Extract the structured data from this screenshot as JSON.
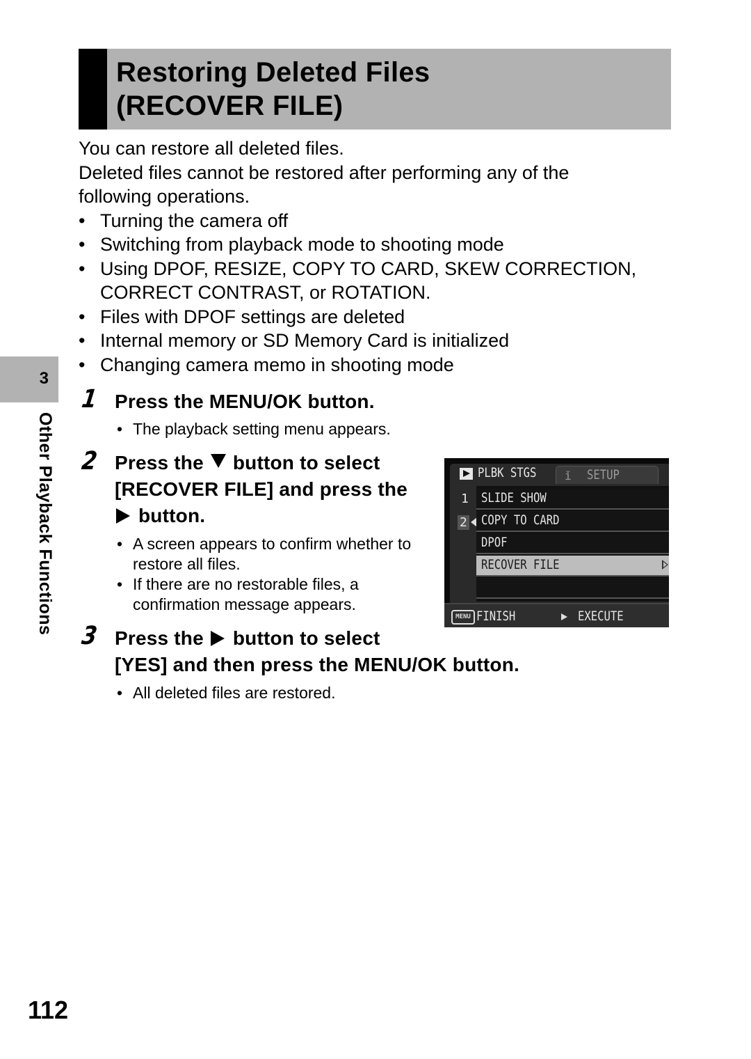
{
  "header": {
    "title_line1": "Restoring Deleted Files",
    "title_line2": "(RECOVER FILE)"
  },
  "intro": {
    "line1": "You can restore all deleted files.",
    "line2": "Deleted files cannot be restored after performing any of the following operations.",
    "bullets": [
      "Turning the camera off",
      "Switching from playback mode to shooting mode",
      "Using DPOF, RESIZE, COPY TO CARD, SKEW CORRECTION, CORRECT CONTRAST, or ROTATION.",
      "Files with DPOF settings are deleted",
      "Internal memory or SD Memory Card is initialized",
      "Changing camera memo in shooting mode"
    ]
  },
  "side_tab": {
    "chapter_number": "3",
    "chapter_label": "Other Playback Functions"
  },
  "steps": [
    {
      "number": "1",
      "heading": "Press the MENU/OK button.",
      "notes": [
        "The playback setting menu appears."
      ]
    },
    {
      "number": "2",
      "heading_part1": "Press the",
      "heading_icon1": "down-arrow-button",
      "heading_part2": "button to select",
      "heading_part3": "[RECOVER FILE] and press the",
      "heading_icon2": "right-arrow-button",
      "heading_part4": "button.",
      "notes": [
        "A screen appears to confirm whether to restore all files.",
        "If there are no restorable files, a confirmation message appears."
      ]
    },
    {
      "number": "3",
      "heading_part1": "Press the",
      "heading_icon1": "right-arrow-button",
      "heading_part2": "button to select",
      "heading_part3": "[YES] and then press the MENU/OK button.",
      "notes": [
        "All deleted files are restored."
      ]
    }
  ],
  "camera_screen": {
    "tabs": [
      {
        "icon": "play-icon",
        "label": "PLBK STGS",
        "active": true
      },
      {
        "icon": "wrench-icon",
        "label": "SETUP",
        "active": false
      }
    ],
    "page_numbers": [
      "1",
      "2"
    ],
    "items": [
      {
        "label": "SLIDE SHOW",
        "selected": false
      },
      {
        "label": "COPY TO CARD",
        "selected": false
      },
      {
        "label": "DPOF",
        "selected": false
      },
      {
        "label": "RECOVER FILE",
        "selected": true
      },
      {
        "label": "",
        "selected": false
      }
    ],
    "footer": {
      "menu_icon_text": "MENU",
      "finish_label": "FINISH",
      "execute_label": "EXECUTE"
    }
  },
  "page_number": "112"
}
